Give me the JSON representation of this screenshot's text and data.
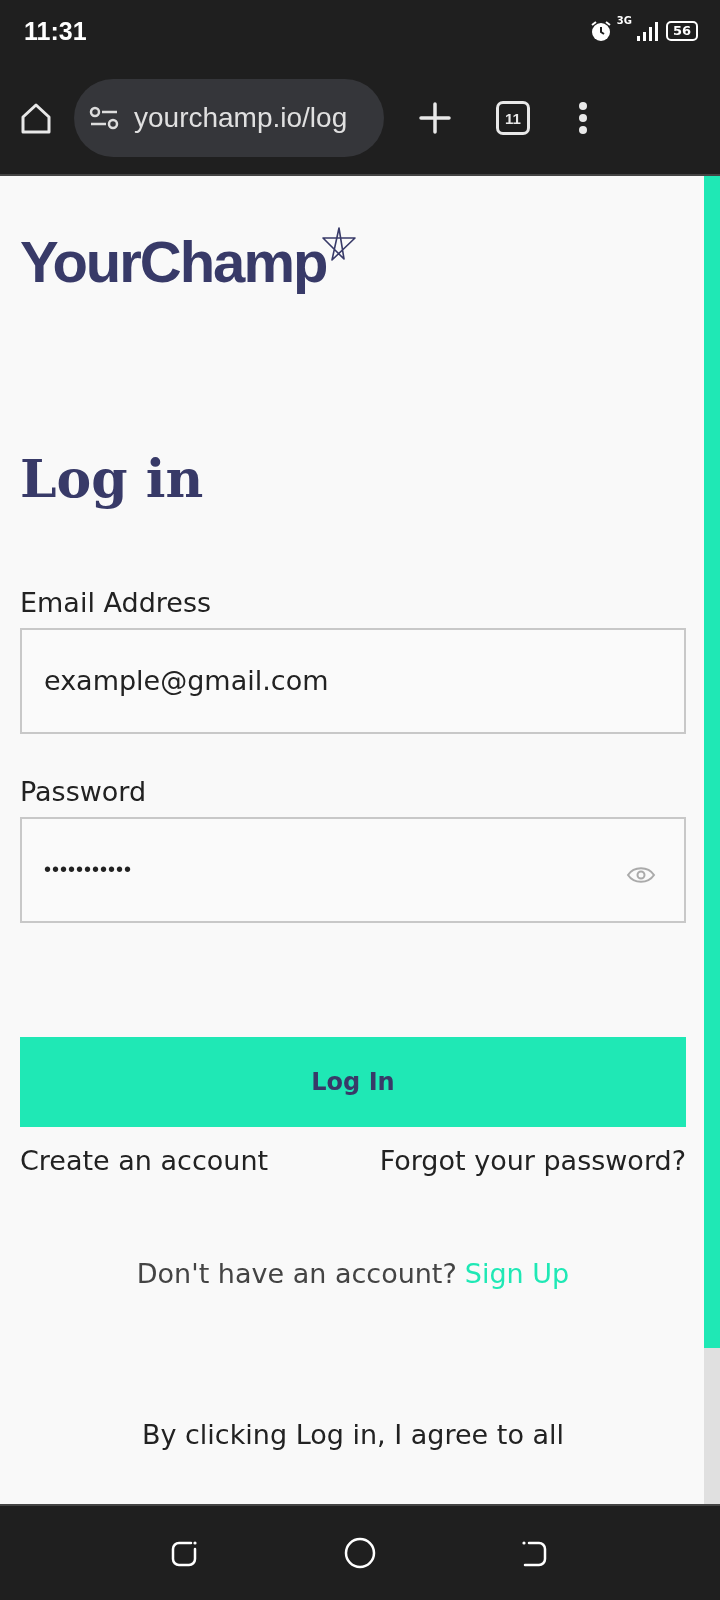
{
  "status_bar": {
    "time": "11:31",
    "network": "3G",
    "battery": "56"
  },
  "browser": {
    "url": "yourchamp.io/log",
    "tab_count": "11"
  },
  "logo": {
    "text": "YourChamp"
  },
  "heading": "Log in",
  "fields": [
    {
      "label": "Email Address",
      "value": "example@gmail.com",
      "kind": "text"
    },
    {
      "label": "Password",
      "value": "•••••••••••",
      "kind": "password"
    }
  ],
  "login_button": "Log In",
  "links": [
    "Create an account",
    "Forgot your password?"
  ],
  "signup": {
    "text": "Don't have an account?",
    "link": "Sign Up"
  },
  "terms": "By clicking Log in, I agree to all"
}
